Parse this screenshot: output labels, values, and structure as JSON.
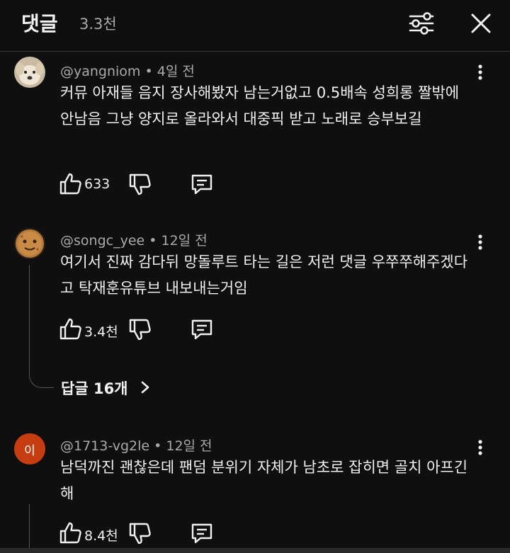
{
  "header": {
    "title": "댓글",
    "count": "3.3천"
  },
  "comments": [
    {
      "author": "@yangniom",
      "time": "4일 전",
      "text": "커뮤 아재들 음지 장사해봤자 남는거없고 0.5배속 성희롱 짤밖에 안남음 그냥 양지로 올라와서 대중픽 받고 노래로 승부보길",
      "likes": "633",
      "avatar": "dog-avatar"
    },
    {
      "author": "@songc_yee",
      "time": "12일 전",
      "text": "여기서 진짜 감다뒤 망돌루트 타는 길은 저런 댓글 우쭈쭈해주겠다고 탁재훈유튜브 내보내는거임",
      "likes": "3.4천",
      "avatar": "cookie-avatar",
      "replies_label": "답글 16개"
    },
    {
      "author": "@1713-vg2le",
      "time": "12일 전",
      "text": "남덕까진 괜찮은데 팬덤 분위기 자체가 남초로 잡히면 골치 아프긴 해",
      "likes": "8.4천",
      "avatar_letter": "이",
      "avatar_color": "#c63d12"
    }
  ],
  "separator": " • "
}
